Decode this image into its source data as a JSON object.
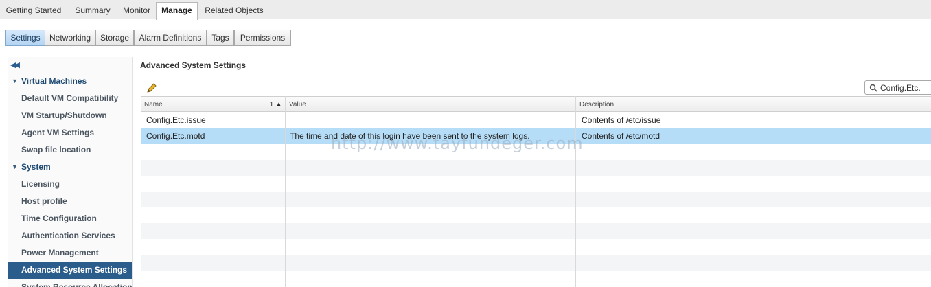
{
  "top_tabs": [
    {
      "label": "Getting Started"
    },
    {
      "label": "Summary"
    },
    {
      "label": "Monitor"
    },
    {
      "label": "Manage"
    },
    {
      "label": "Related Objects"
    }
  ],
  "sub_tabs": [
    {
      "label": "Settings"
    },
    {
      "label": "Networking"
    },
    {
      "label": "Storage"
    },
    {
      "label": "Alarm Definitions"
    },
    {
      "label": "Tags"
    },
    {
      "label": "Permissions"
    }
  ],
  "nav": {
    "groups": [
      {
        "label": "Virtual Machines",
        "items": [
          "Default VM Compatibility",
          "VM Startup/Shutdown",
          "Agent VM Settings",
          "Swap file location"
        ]
      },
      {
        "label": "System",
        "items": [
          "Licensing",
          "Host profile",
          "Time Configuration",
          "Authentication Services",
          "Power Management",
          "Advanced System Settings",
          "System Resource Allocation"
        ]
      }
    ],
    "selected": "Advanced System Settings"
  },
  "panel": {
    "title": "Advanced System Settings",
    "search_value": "Config.Etc.",
    "columns": [
      "Name",
      "Value",
      "Description"
    ],
    "sort_indicator": "1 ▲",
    "rows": [
      {
        "name": "Config.Etc.issue",
        "value": "",
        "description": "Contents of /etc/issue"
      },
      {
        "name": "Config.Etc.motd",
        "value": "The time and date of this login have been sent to the system logs.",
        "description": "Contents of /etc/motd"
      }
    ]
  },
  "watermark": "http://www.tayfundeger.com",
  "colors": {
    "accent": "#2a5c8c",
    "selected_row": "#b6ddf7"
  },
  "icons": {
    "collapse": "double-chevron-left-icon",
    "edit": "pencil-icon",
    "search": "magnifier-icon"
  }
}
